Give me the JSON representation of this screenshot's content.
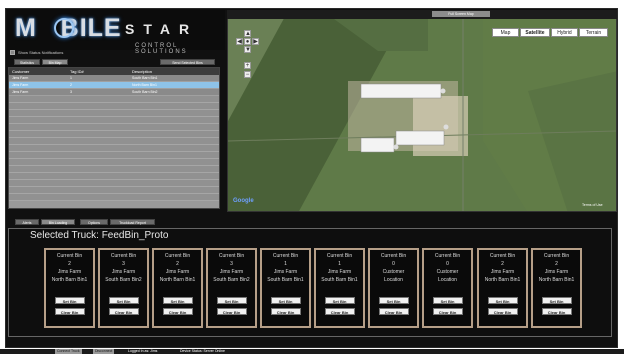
{
  "logo": {
    "word": "MOBILE",
    "star": "STAR",
    "subtitle": "CONTROL SOLUTIONS"
  },
  "options": {
    "checkbox_label": "Show Status Notifications"
  },
  "left_tabs": [
    {
      "label": "Statistics"
    },
    {
      "label": "Bin Map"
    },
    {
      "label": "Send Selected Bins"
    }
  ],
  "grid": {
    "headers": [
      "Customer",
      "Tag ID#",
      "Description"
    ],
    "rows": [
      {
        "customer": "Jims Farm",
        "tag": "1",
        "desc": "South Barn Bin1",
        "selected": false
      },
      {
        "customer": "Jims Farm",
        "tag": "2",
        "desc": "North Barn Bin1",
        "selected": true
      },
      {
        "customer": "Jims Farm",
        "tag": "3",
        "desc": "South Barn Bin2",
        "selected": false
      }
    ]
  },
  "map": {
    "title": "Full Screen Map",
    "types": [
      {
        "label": "Map"
      },
      {
        "label": "Satellite"
      },
      {
        "label": "Hybrid"
      },
      {
        "label": "Terrain"
      }
    ],
    "google": "Google",
    "terms": "Terms of Use"
  },
  "bottom_tabs": [
    {
      "label": "Alerts"
    },
    {
      "label": "Bin Loading"
    },
    {
      "label": "Options"
    },
    {
      "label": "Truckload Report"
    }
  ],
  "truck": {
    "label": "Selected Truck:",
    "name": "FeedBin_Proto"
  },
  "bins": [
    {
      "head": "Current Bin",
      "num": "2",
      "farm": "Jims Farm",
      "loc": "North Barn Bin1"
    },
    {
      "head": "Current Bin",
      "num": "3",
      "farm": "Jims Farm",
      "loc": "South Barn Bin2"
    },
    {
      "head": "Current Bin",
      "num": "2",
      "farm": "Jims Farm",
      "loc": "North Barn Bin1"
    },
    {
      "head": "Current Bin",
      "num": "3",
      "farm": "Jims Farm",
      "loc": "South Barn Bin2"
    },
    {
      "head": "Current Bin",
      "num": "1",
      "farm": "Jims Farm",
      "loc": "South Barn Bin1"
    },
    {
      "head": "Current Bin",
      "num": "1",
      "farm": "Jims Farm",
      "loc": "South Barn Bin1"
    },
    {
      "head": "Current Bin",
      "num": "0",
      "farm": "Customer",
      "loc": "Location"
    },
    {
      "head": "Current Bin",
      "num": "0",
      "farm": "Customer",
      "loc": "Location"
    },
    {
      "head": "Current Bin",
      "num": "2",
      "farm": "Jims Farm",
      "loc": "North Barn Bin1"
    },
    {
      "head": "Current Bin",
      "num": "2",
      "farm": "Jims Farm",
      "loc": "North Barn Bin1"
    }
  ],
  "bin_buttons": {
    "set": "Set Bin",
    "clear": "Clear Bin"
  },
  "status": {
    "a": "Connect Truck",
    "b": "Disconnect",
    "c": "Logged In as: Jims",
    "d": "Device Status: Server Online"
  }
}
